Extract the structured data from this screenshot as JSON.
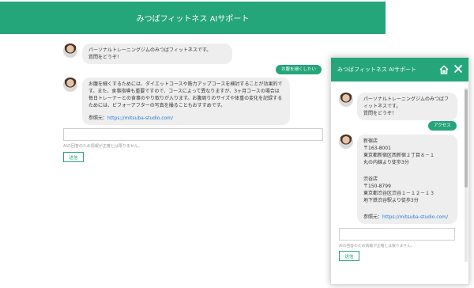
{
  "colors": {
    "brand": "#25a57a",
    "bubble_bg": "#eeeeee",
    "link": "#2a7bd6"
  },
  "main": {
    "title": "みつばフィットネス AIサポート",
    "greeting": {
      "line1": "パーソナルトレーニングジムのみつばフィットネスです。",
      "line2": "質問をどうぞ！"
    },
    "user_message": "お腹を細くしたい",
    "answer": {
      "text": "お腹を細くするためには、ダイエットコースや筋力アップコースを検討することが効果的です。また、食事指導も重要ですので、コースによって異なりますが、3ヶ月コースの場合は毎日トレーナーとの食事のやり取りが入ります。お腹周りのサイズや体重の変化を記録するためには、ビフォーアフターの写真を撮ることもおすすめです。",
      "reference_label": "参照元：",
      "reference_link": "https://mitsuba-studio.com/"
    },
    "input_placeholder": "",
    "disclaimer": "AIの回答のため情報が正確とは限りません。",
    "send_label": "送信"
  },
  "widget": {
    "title": "みつばフィットネス AIサポート",
    "home_icon": "home-icon",
    "close_icon": "close-icon",
    "greeting": {
      "line1": "パーソナルトレーニングジムのみつばフィットネスです。",
      "line2": "質問をどうぞ！"
    },
    "user_message": "アクセス",
    "answer": {
      "store1": {
        "name": "新宿店",
        "zip": "〒163-8001",
        "address": "東京都新宿区西新宿２丁目８－１",
        "access": "丸の内線より徒歩3分"
      },
      "store2": {
        "name": "渋谷店",
        "zip": "〒150-8799",
        "address": "東京都渋谷区渋谷１－１２－１３",
        "access": "地下鉄渋谷駅より徒歩3分"
      },
      "reference_label": "参照元：",
      "reference_link": "https://mitsuba-studio.com/"
    },
    "disclaimer": "AIの回答のため情報が正確とは限りません。",
    "send_label": "送信"
  }
}
